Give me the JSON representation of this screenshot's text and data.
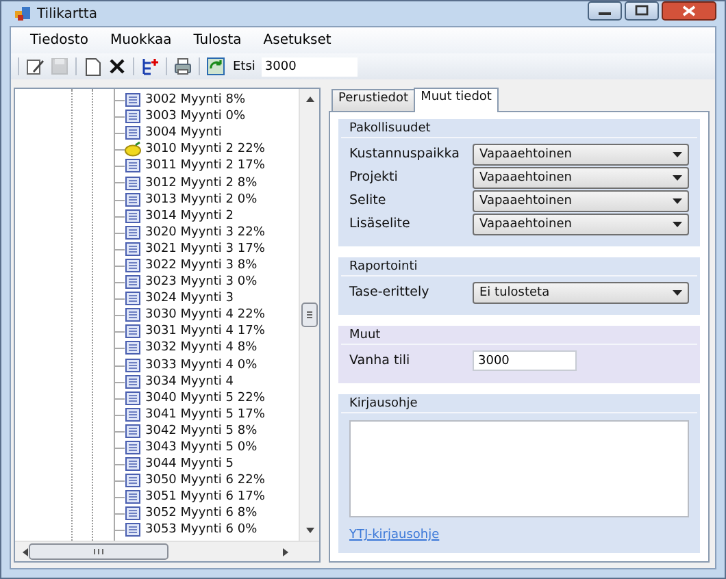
{
  "window": {
    "title": "Tilikartta"
  },
  "menu": [
    "Tiedosto",
    "Muokkaa",
    "Tulosta",
    "Asetukset"
  ],
  "toolbar": {
    "buttons": [
      {
        "kind": "edit",
        "disabled": false
      },
      {
        "kind": "save",
        "disabled": true
      },
      {
        "kind": "new",
        "disabled": false
      },
      {
        "kind": "delete",
        "disabled": false
      },
      {
        "kind": "tree",
        "disabled": false
      },
      {
        "kind": "print",
        "disabled": false
      },
      {
        "kind": "refresh",
        "disabled": false
      }
    ],
    "search_label": "Etsi",
    "search_value": "3000"
  },
  "tree": {
    "items": [
      {
        "label": "3002 Myynti 8%",
        "kind": "doc"
      },
      {
        "label": "3003 Myynti 0%",
        "kind": "doc"
      },
      {
        "label": "3004 Myynti",
        "kind": "doc"
      },
      {
        "label": "3010 Myynti 2 22%",
        "kind": "lemon"
      },
      {
        "label": "3011 Myynti 2 17%",
        "kind": "doc"
      },
      {
        "label": "3012 Myynti 2 8%",
        "kind": "doc"
      },
      {
        "label": "3013 Myynti 2 0%",
        "kind": "doc"
      },
      {
        "label": "3014 Myynti 2",
        "kind": "doc"
      },
      {
        "label": "3020 Myynti 3 22%",
        "kind": "doc"
      },
      {
        "label": "3021 Myynti 3 17%",
        "kind": "doc"
      },
      {
        "label": "3022 Myynti 3 8%",
        "kind": "doc"
      },
      {
        "label": "3023 Myynti 3 0%",
        "kind": "doc"
      },
      {
        "label": "3024 Myynti 3",
        "kind": "doc"
      },
      {
        "label": "3030 Myynti 4 22%",
        "kind": "doc"
      },
      {
        "label": "3031 Myynti 4 17%",
        "kind": "doc"
      },
      {
        "label": "3032 Myynti 4 8%",
        "kind": "doc"
      },
      {
        "label": "3033 Myynti 4 0%",
        "kind": "doc"
      },
      {
        "label": "3034 Myynti 4",
        "kind": "doc"
      },
      {
        "label": "3040 Myynti 5 22%",
        "kind": "doc"
      },
      {
        "label": "3041 Myynti 5 17%",
        "kind": "doc"
      },
      {
        "label": "3042 Myynti 5 8%",
        "kind": "doc"
      },
      {
        "label": "3043 Myynti 5 0%",
        "kind": "doc"
      },
      {
        "label": "3044 Myynti 5",
        "kind": "doc"
      },
      {
        "label": "3050 Myynti 6 22%",
        "kind": "doc"
      },
      {
        "label": "3051 Myynti 6 17%",
        "kind": "doc"
      },
      {
        "label": "3052 Myynti 6 8%",
        "kind": "doc"
      },
      {
        "label": "3053 Myynti 6 0%",
        "kind": "doc"
      }
    ]
  },
  "tabs": [
    {
      "label": "Perustiedot",
      "selected": false
    },
    {
      "label": "Muut tiedot",
      "selected": true
    }
  ],
  "groups": [
    {
      "kind": "combos",
      "title": "Pakollisuudet",
      "rows": [
        {
          "label": "Kustannuspaikka",
          "value": "Vapaaehtoinen"
        },
        {
          "label": "Projekti",
          "value": "Vapaaehtoinen"
        },
        {
          "label": "Selite",
          "value": "Vapaaehtoinen"
        },
        {
          "label": "Lisäselite",
          "value": "Vapaaehtoinen"
        }
      ]
    },
    {
      "kind": "combos",
      "title": "Raportointi",
      "rows": [
        {
          "label": "Tase-erittely",
          "value": "Ei tulosteta"
        }
      ]
    },
    {
      "kind": "field",
      "title": "Muut",
      "label": "Vanha tili",
      "value": "3000"
    },
    {
      "kind": "notes",
      "title": "Kirjausohje",
      "link": "YTJ-kirjausohje"
    }
  ]
}
